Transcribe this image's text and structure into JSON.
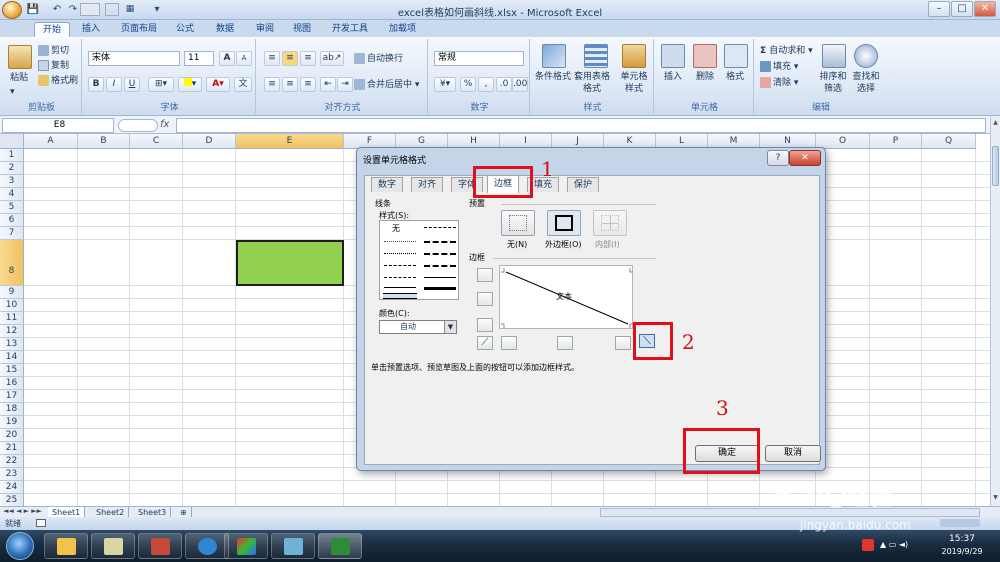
{
  "window": {
    "title": "excel表格如何画斜线.xlsx - Microsoft Excel",
    "min": "–",
    "max": "□",
    "close": "✕"
  },
  "quick_access": [
    "💾",
    "↶",
    "↷",
    "▾"
  ],
  "tabs": [
    "开始",
    "插入",
    "页面布局",
    "公式",
    "数据",
    "审阅",
    "视图",
    "开发工具",
    "加载项"
  ],
  "ribbon": {
    "clipboard": {
      "label": "剪贴板",
      "paste": "粘贴",
      "cut": "剪切",
      "copy": "复制",
      "format_painter": "格式刷"
    },
    "font": {
      "label": "字体",
      "name": "宋体",
      "size": "11",
      "bold": "B",
      "italic": "I",
      "underline": "U",
      "grow": "A",
      "shrink": "A"
    },
    "align": {
      "label": "对齐方式",
      "wrap": "自动换行",
      "merge": "合并后居中"
    },
    "number": {
      "label": "数字",
      "format": "常规",
      "percent": "%",
      "comma": ","
    },
    "styles": {
      "label": "样式",
      "cond": "条件格式",
      "table": "套用表格格式",
      "cell": "单元格样式"
    },
    "cells": {
      "label": "单元格",
      "insert": "插入",
      "delete": "删除",
      "format": "格式"
    },
    "edit": {
      "label": "编辑",
      "autosum": "自动求和",
      "fill": "填充",
      "clear": "清除",
      "sort": "排序和筛选",
      "find": "查找和选择"
    }
  },
  "formula_bar": {
    "name_box": "E8",
    "fx": "fx",
    "value": ""
  },
  "columns": [
    "A",
    "B",
    "C",
    "D",
    "E",
    "F",
    "G",
    "H",
    "I",
    "J",
    "K",
    "L",
    "M",
    "N",
    "O",
    "P",
    "Q"
  ],
  "rows": [
    "1",
    "2",
    "3",
    "4",
    "5",
    "6",
    "7",
    "8",
    "9",
    "10",
    "11",
    "12",
    "13",
    "14",
    "15",
    "16",
    "17",
    "18",
    "19",
    "20",
    "21",
    "22",
    "23",
    "24",
    "25"
  ],
  "selected_cell": "E8",
  "selected_fill": "#92d050",
  "sheets": [
    "Sheet1",
    "Sheet2",
    "Sheet3"
  ],
  "status": "就绪",
  "dialog": {
    "title": "设置单元格格式",
    "tabs": [
      "数字",
      "对齐",
      "字体",
      "边框",
      "填充",
      "保护"
    ],
    "active_tab": "边框",
    "line_section": "线条",
    "style_label": "样式(S):",
    "none_label": "无",
    "color_label": "颜色(C):",
    "color_value": "自动",
    "preset_section": "预置",
    "presets": [
      "无(N)",
      "外边框(O)",
      "内部(I)"
    ],
    "border_section": "边框",
    "preview_text": "文本",
    "hint": "单击预置选项、预览草图及上面的按钮可以添加边框样式。",
    "ok": "确定",
    "cancel": "取消",
    "help": "?",
    "close": "✕"
  },
  "annotations": [
    "1",
    "2",
    "3"
  ],
  "taskbar": {
    "time": "15:37",
    "date": "2019/9/29"
  },
  "watermark": {
    "text": "Bai",
    "sub": "jingyan.baidu.com",
    "extra": "经验"
  }
}
